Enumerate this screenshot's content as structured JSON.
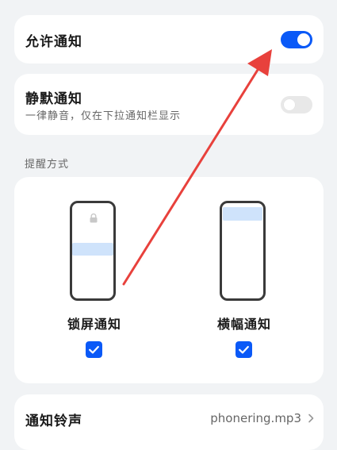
{
  "colors": {
    "accent": "#0a59f7",
    "toggle_off": "#e8e8e8",
    "banner_preview": "#cfe3fb",
    "annotation_arrow": "#e8413c"
  },
  "allow_notifications": {
    "label": "允许通知",
    "enabled": true
  },
  "silent_notifications": {
    "label": "静默通知",
    "description": "一律静音，仅在下拉通知栏显示",
    "enabled": false
  },
  "reminder_style": {
    "section_label": "提醒方式",
    "options": [
      {
        "label": "锁屏通知",
        "checked": true,
        "icon": "lock-icon"
      },
      {
        "label": "横幅通知",
        "checked": true,
        "icon": "banner-preview"
      }
    ]
  },
  "ringtone": {
    "label": "通知铃声",
    "value": "phonering.mp3"
  }
}
